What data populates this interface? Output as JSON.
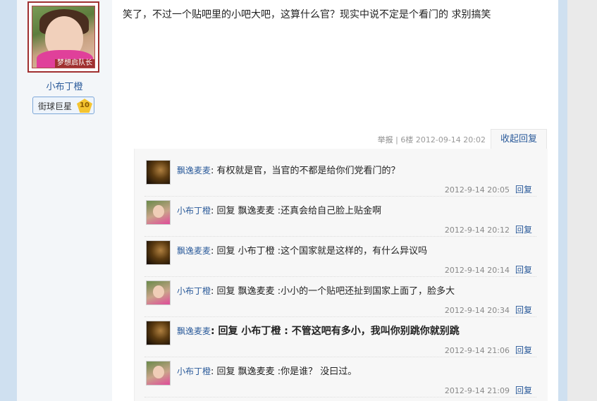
{
  "author": {
    "name": "小布丁橙",
    "avatar_badge": "梦想启队长",
    "rank_title": "街球巨星",
    "rank_level": "10"
  },
  "post": {
    "content": "笑了，不过一个贴吧里的小吧大吧，这算什么官？现实中说不定是个看门的  求别搞笑",
    "report_label": "举报",
    "floor": "6楼",
    "timestamp": "2012-09-14 20:02",
    "collapse_label": "收起回复"
  },
  "replies": [
    {
      "user": "飘逸麦麦",
      "text": "有权就是官，当官的不都是给你们党看门的？",
      "time": "2012-9-14 20:05",
      "reply_label": "回复",
      "avatar": "dark-avatar"
    },
    {
      "user": "小布丁橙",
      "text": "回复 飘逸麦麦 :还真会给自己脸上贴金啊",
      "time": "2012-9-14 20:12",
      "reply_label": "回复",
      "avatar": "girl-avatar"
    },
    {
      "user": "飘逸麦麦",
      "text": "回复 小布丁橙 :这个国家就是这样的，有什么异议吗",
      "time": "2012-9-14 20:14",
      "reply_label": "回复",
      "avatar": "dark-avatar"
    },
    {
      "user": "小布丁橙",
      "text": "回复 飘逸麦麦 :小小的一个贴吧还扯到国家上面了，脸多大",
      "time": "2012-9-14 20:34",
      "reply_label": "回复",
      "avatar": "girl-avatar"
    },
    {
      "user": "飘逸麦麦",
      "text": "回复 小布丁橙 : 不管这吧有多小，我叫你别跳你就别跳",
      "time": "2012-9-14 21:06",
      "reply_label": "回复",
      "avatar": "dark-avatar"
    },
    {
      "user": "小布丁橙",
      "text": "回复 飘逸麦麦 :你是谁？ 没曰过。",
      "time": "2012-9-14 21:09",
      "reply_label": "回复",
      "avatar": "girl-avatar"
    }
  ]
}
